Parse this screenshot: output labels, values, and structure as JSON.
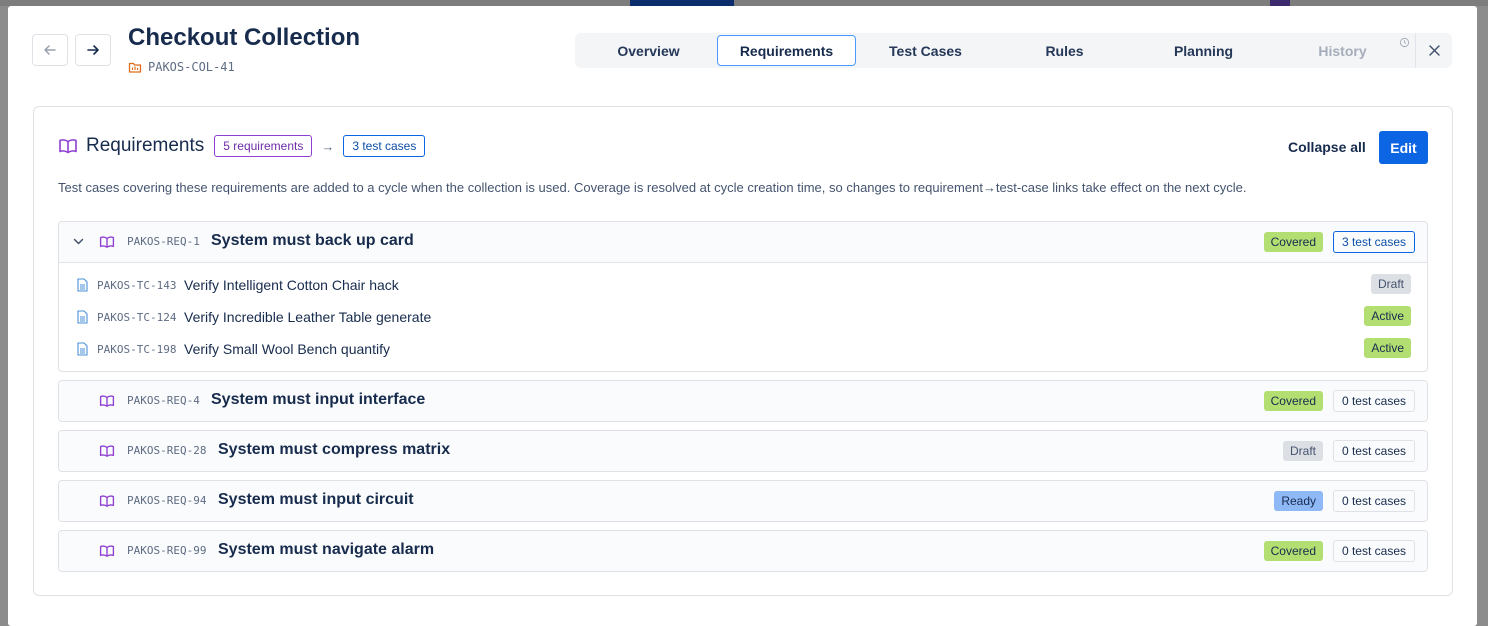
{
  "header": {
    "title": "Checkout Collection",
    "collection_key": "PAKOS-COL-41"
  },
  "tabs": [
    {
      "label": "Overview",
      "state": "normal"
    },
    {
      "label": "Requirements",
      "state": "active"
    },
    {
      "label": "Test Cases",
      "state": "normal"
    },
    {
      "label": "Rules",
      "state": "normal"
    },
    {
      "label": "Planning",
      "state": "normal"
    },
    {
      "label": "History",
      "state": "disabled"
    }
  ],
  "requirements_panel": {
    "title": "Requirements",
    "requirements_badge": "5 requirements",
    "arrow": "→",
    "test_cases_badge": "3 test cases",
    "collapse_all_label": "Collapse all",
    "edit_label": "Edit",
    "description": "Test cases covering these requirements are added to a cycle when the collection is used. Coverage is resolved at cycle creation time, so changes to requirement→test-case links take effect on the next cycle."
  },
  "requirements": [
    {
      "key": "PAKOS-REQ-1",
      "title": "System must back up card",
      "status": "Covered",
      "test_case_count": "3 test cases",
      "expanded": true,
      "test_cases": [
        {
          "key": "PAKOS-TC-143",
          "title": "Verify Intelligent Cotton Chair hack",
          "status": "Draft"
        },
        {
          "key": "PAKOS-TC-124",
          "title": "Verify Incredible Leather Table generate",
          "status": "Active"
        },
        {
          "key": "PAKOS-TC-198",
          "title": "Verify Small Wool Bench quantify",
          "status": "Active"
        }
      ]
    },
    {
      "key": "PAKOS-REQ-4",
      "title": "System must input interface",
      "status": "Covered",
      "test_case_count": "0 test cases",
      "expanded": false
    },
    {
      "key": "PAKOS-REQ-28",
      "title": "System must compress matrix",
      "status": "Draft",
      "test_case_count": "0 test cases",
      "expanded": false
    },
    {
      "key": "PAKOS-REQ-94",
      "title": "System must input circuit",
      "status": "Ready",
      "test_case_count": "0 test cases",
      "expanded": false
    },
    {
      "key": "PAKOS-REQ-99",
      "title": "System must navigate alarm",
      "status": "Covered",
      "test_case_count": "0 test cases",
      "expanded": false
    }
  ],
  "colors": {
    "primary": "#0c66e4",
    "covered": "#b3df72",
    "draft": "#dcdfe4",
    "ready": "#8fb8f6",
    "requirement_icon": "#8f3fd1",
    "test_case_icon": "#4a90d9"
  }
}
